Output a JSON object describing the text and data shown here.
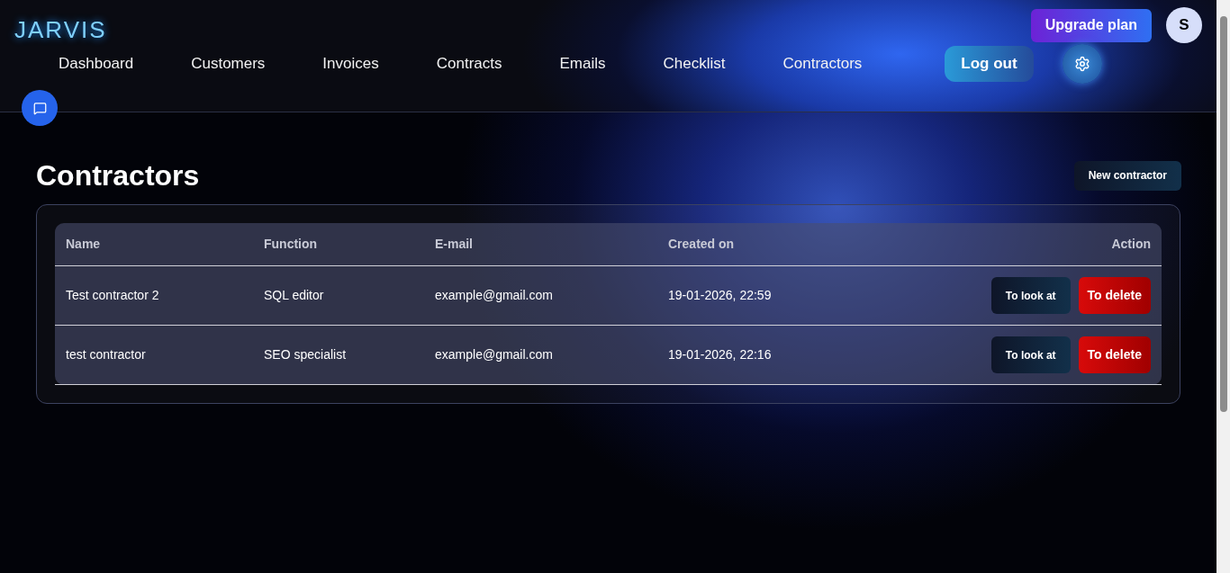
{
  "logo": "JARVIS",
  "nav": [
    {
      "label": "Dashboard"
    },
    {
      "label": "Customers"
    },
    {
      "label": "Invoices"
    },
    {
      "label": "Contracts"
    },
    {
      "label": "Emails"
    },
    {
      "label": "Checklist"
    },
    {
      "label": "Contractors"
    }
  ],
  "logout": "Log out",
  "upgrade": "Upgrade plan",
  "avatar": "S",
  "page_title": "Contractors",
  "new_button": "New contractor",
  "table": {
    "columns": [
      "Name",
      "Function",
      "E-mail",
      "Created on",
      "Action"
    ],
    "rows": [
      {
        "name": "Test contractor 2",
        "function": "SQL editor",
        "email": "example@gmail.com",
        "created": "19-01-2026, 22:59",
        "view": "To look at",
        "delete": "To delete"
      },
      {
        "name": "test contractor",
        "function": "SEO specialist",
        "email": "example@gmail.com",
        "created": "19-01-2026, 22:16",
        "view": "To look at",
        "delete": "To delete"
      }
    ]
  }
}
